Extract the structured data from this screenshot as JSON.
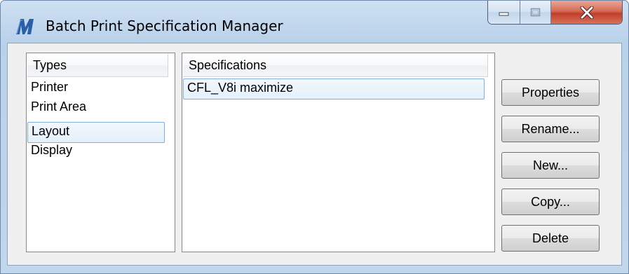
{
  "window": {
    "title": "Batch Print Specification Manager",
    "app_icon": "microstation-m-icon",
    "caption_buttons": [
      "minimize-icon",
      "maximize-icon",
      "close-icon"
    ]
  },
  "types_list": {
    "header": "Types",
    "items": [
      {
        "label": "Printer",
        "selected": false
      },
      {
        "label": "Print Area",
        "selected": false
      },
      {
        "label": "Layout",
        "selected": true
      },
      {
        "label": "Display",
        "selected": false
      }
    ]
  },
  "specifications_list": {
    "header": "Specifications",
    "items": [
      {
        "label": "CFL_V8i maximize",
        "selected": true
      }
    ]
  },
  "buttons": {
    "properties": "Properties",
    "rename": "Rename...",
    "new": "New...",
    "copy": "Copy...",
    "delete": "Delete"
  },
  "colors": {
    "title_gradient": "#c2d6ec",
    "selection_border": "#84acdd",
    "close_button": "#c1402a"
  }
}
